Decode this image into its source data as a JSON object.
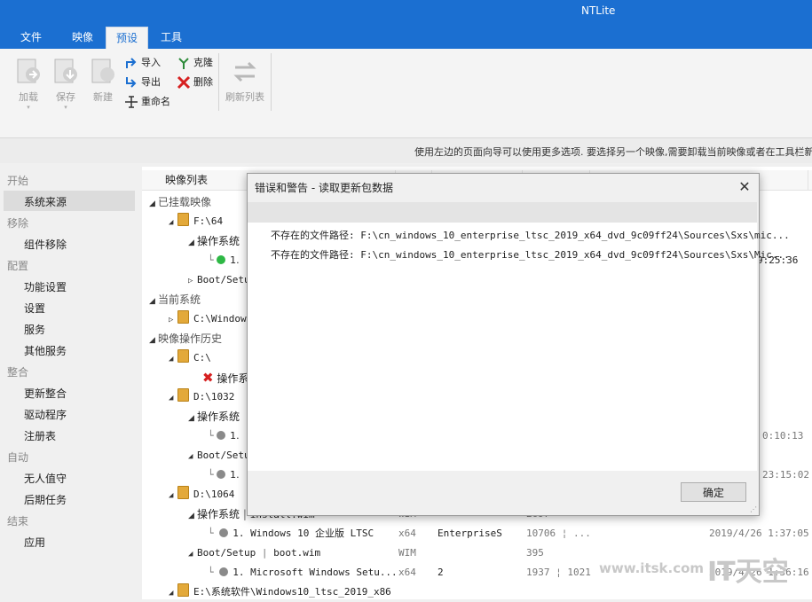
{
  "app": {
    "title": "NTLite"
  },
  "tabs": [
    "文件",
    "映像",
    "预设",
    "工具"
  ],
  "ribbon": {
    "load": "加载",
    "save": "保存",
    "new": "新建",
    "import": "导入",
    "export": "导出",
    "rename": "重命名",
    "clone": "克隆",
    "delete": "删除",
    "refresh": "刷新列表"
  },
  "info_text": "使用左边的页面向导可以使用更多选项. 要选择另一个映像,需要卸载当前映像或者在工具栏新",
  "nav": {
    "start": "开始",
    "source": "系统来源",
    "remove": "移除",
    "component_remove": "组件移除",
    "config": "配置",
    "features": "功能设置",
    "settings": "设置",
    "services": "服务",
    "other_services": "其他服务",
    "integrate": "整合",
    "updates": "更新整合",
    "drivers": "驱动程序",
    "registry": "注册表",
    "auto": "自动",
    "unattended": "无人值守",
    "post_tasks": "后期任务",
    "finish": "结束",
    "apply": "应用"
  },
  "table": {
    "header": "映像列表",
    "mounted": "已挂载映像",
    "f64": "F:\\64",
    "os": "操作系统",
    "one": "1.",
    "boot": "Boot/Setu",
    "bootsetup": "Boot/Setup",
    "current": "当前系统",
    "cwin": "C:\\Window",
    "history": "映像操作历史",
    "c": "C:\\",
    "oscut": "操作系",
    "d1032": "D:\\1032",
    "d1064": "D:\\1064",
    "install_wim": "install.wim",
    "wim": "WIM",
    "r1_name": "1. Windows 10 企业版 LTSC",
    "x64": "x64",
    "enterprise": "EnterpriseS",
    "build1": "10706 ¦ ...",
    "date1": "2019/4/26 1:37:05",
    "boot_wim": "boot.wim",
    "wim395": "395",
    "r2_name": "1. Microsoft Windows Setu...",
    "two": "2",
    "build2": "1937 ¦ 1021",
    "date2": "2019/4/26 1:36:16",
    "e_path": "E:\\系统软件\\Windows10_ltsc_2019_x86",
    "pipe": "|",
    "t1": "9:25:36",
    "t2": "0:10:13",
    "t3": "23:15:02",
    "n2697": "2697"
  },
  "dialog": {
    "title": "错误和警告 - 读取更新包数据",
    "line1": "不存在的文件路径: F:\\cn_windows_10_enterprise_ltsc_2019_x64_dvd_9c09ff24\\Sources\\Sxs\\mic...",
    "line2": "不存在的文件路径: F:\\cn_windows_10_enterprise_ltsc_2019_x64_dvd_9c09ff24\\Sources\\Sxs\\Mic...",
    "ok": "确定",
    "close": "✕"
  },
  "watermark": {
    "url": "www.itsk.com",
    "logo": "IT天空"
  }
}
